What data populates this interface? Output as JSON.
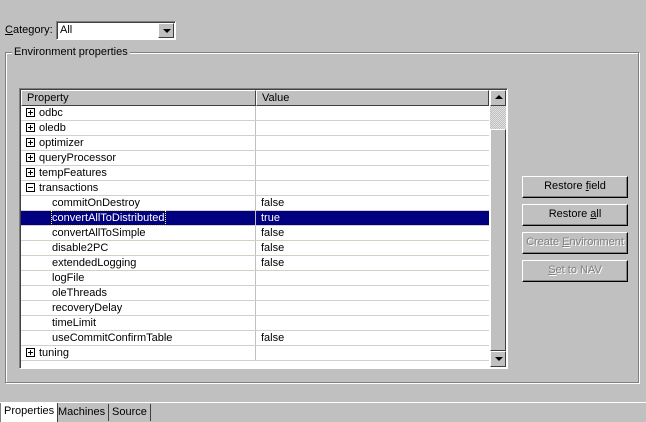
{
  "category": {
    "label_prefix": "",
    "label_underlined": "C",
    "label_rest": "ategory:",
    "selected": "All"
  },
  "group": {
    "title": "Environment properties"
  },
  "grid": {
    "columns": {
      "property": "Property",
      "value": "Value"
    },
    "rows": [
      {
        "name": "odbc",
        "value": "",
        "expander": "plus",
        "level": 0
      },
      {
        "name": "oledb",
        "value": "",
        "expander": "plus",
        "level": 0
      },
      {
        "name": "optimizer",
        "value": "",
        "expander": "plus",
        "level": 0
      },
      {
        "name": "queryProcessor",
        "value": "",
        "expander": "plus",
        "level": 0
      },
      {
        "name": "tempFeatures",
        "value": "",
        "expander": "plus",
        "level": 0
      },
      {
        "name": "transactions",
        "value": "",
        "expander": "minus",
        "level": 0
      },
      {
        "name": "commitOnDestroy",
        "value": "false",
        "level": 1
      },
      {
        "name": "convertAllToDistributed",
        "value": "true",
        "level": 1,
        "selected": true
      },
      {
        "name": "convertAllToSimple",
        "value": "false",
        "level": 1
      },
      {
        "name": "disable2PC",
        "value": "false",
        "level": 1
      },
      {
        "name": "extendedLogging",
        "value": "false",
        "level": 1
      },
      {
        "name": "logFile",
        "value": "",
        "level": 1
      },
      {
        "name": "oleThreads",
        "value": "",
        "level": 1
      },
      {
        "name": "recoveryDelay",
        "value": "",
        "level": 1
      },
      {
        "name": "timeLimit",
        "value": "",
        "level": 1
      },
      {
        "name": "useCommitConfirmTable",
        "value": "false",
        "level": 1
      },
      {
        "name": "tuning",
        "value": "",
        "expander": "plus",
        "level": 0
      }
    ]
  },
  "buttons": {
    "restore_field": {
      "pre": "Restore ",
      "u": "f",
      "post": "ield",
      "enabled": true
    },
    "restore_all": {
      "pre": "Restore ",
      "u": "a",
      "post": "ll",
      "enabled": true
    },
    "create_env": {
      "pre": "Create ",
      "u": "E",
      "post": "nvironment",
      "enabled": false
    },
    "set_nav": {
      "pre": "",
      "u": "S",
      "post": "et to NAV",
      "enabled": false
    }
  },
  "tabs": [
    {
      "label": "Properties",
      "active": true
    },
    {
      "label": "Machines",
      "active": false
    },
    {
      "label": "Source",
      "active": false
    }
  ],
  "colors": {
    "face": "#c0c0c0",
    "selection": "#000080"
  }
}
